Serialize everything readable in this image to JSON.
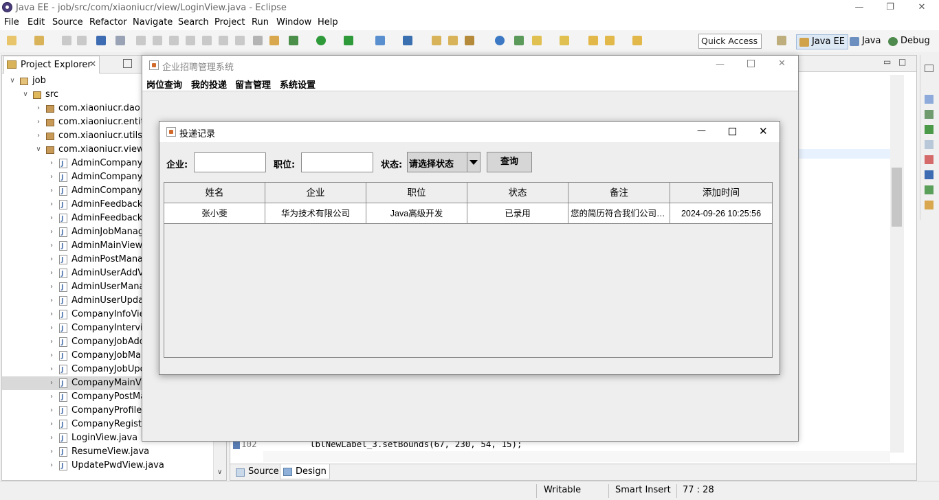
{
  "eclipse": {
    "title": "Java EE - job/src/com/xiaoniucr/view/LoginView.java - Eclipse",
    "menu": [
      "File",
      "Edit",
      "Source",
      "Refactor",
      "Navigate",
      "Search",
      "Project",
      "Run",
      "Window",
      "Help"
    ],
    "quick_access": "Quick Access",
    "perspectives": [
      "Java EE",
      "Java",
      "Debug"
    ],
    "explorer_tab": "Project Explorer",
    "tree": [
      {
        "label": "job",
        "level": 0,
        "type": "project",
        "expanded": true
      },
      {
        "label": "src",
        "level": 1,
        "type": "folder",
        "expanded": true
      },
      {
        "label": "com.xiaoniucr.dao",
        "level": 2,
        "type": "package",
        "expanded": false
      },
      {
        "label": "com.xiaoniucr.entity",
        "level": 2,
        "type": "package",
        "expanded": false
      },
      {
        "label": "com.xiaoniucr.utils",
        "level": 2,
        "type": "package",
        "expanded": false
      },
      {
        "label": "com.xiaoniucr.view",
        "level": 2,
        "type": "package",
        "expanded": true
      },
      {
        "label": "AdminCompanyA",
        "level": 3,
        "type": "java"
      },
      {
        "label": "AdminCompanyM",
        "level": 3,
        "type": "java"
      },
      {
        "label": "AdminCompanyU",
        "level": 3,
        "type": "java"
      },
      {
        "label": "AdminFeedbackM",
        "level": 3,
        "type": "java"
      },
      {
        "label": "AdminFeedbackR",
        "level": 3,
        "type": "java"
      },
      {
        "label": "AdminJobManag",
        "level": 3,
        "type": "java"
      },
      {
        "label": "AdminMainView.j",
        "level": 3,
        "type": "java"
      },
      {
        "label": "AdminPostManag",
        "level": 3,
        "type": "java"
      },
      {
        "label": "AdminUserAddVi",
        "level": 3,
        "type": "java"
      },
      {
        "label": "AdminUserManag",
        "level": 3,
        "type": "java"
      },
      {
        "label": "AdminUserUpdat",
        "level": 3,
        "type": "java"
      },
      {
        "label": "CompanyInfoView",
        "level": 3,
        "type": "java"
      },
      {
        "label": "CompanyIntervie",
        "level": 3,
        "type": "java"
      },
      {
        "label": "CompanyJobAdd",
        "level": 3,
        "type": "java"
      },
      {
        "label": "CompanyJobMar",
        "level": 3,
        "type": "java"
      },
      {
        "label": "CompanyJobUpd",
        "level": 3,
        "type": "java"
      },
      {
        "label": "CompanyMainVie",
        "level": 3,
        "type": "java",
        "selected": true
      },
      {
        "label": "CompanyPostMa",
        "level": 3,
        "type": "java"
      },
      {
        "label": "CompanyProfileV",
        "level": 3,
        "type": "java"
      },
      {
        "label": "CompanyRegister",
        "level": 3,
        "type": "java"
      },
      {
        "label": "LoginView.java",
        "level": 3,
        "type": "java"
      },
      {
        "label": "ResumeView.java",
        "level": 3,
        "type": "java"
      },
      {
        "label": "UpdatePwdView.java",
        "level": 3,
        "type": "java"
      }
    ],
    "editor_line_number": "102",
    "editor_code": "lblNewLabel_3.setBounds(67, 230, 54, 15);",
    "editor_tabs": [
      "Source",
      "Design"
    ],
    "status": [
      "Writable",
      "Smart Insert",
      "77 : 28"
    ]
  },
  "main_window": {
    "title": "企业招聘管理系统",
    "menu": [
      "岗位查询",
      "我的投递",
      "留言管理",
      "系统设置"
    ]
  },
  "dialog": {
    "title": "投递记录",
    "company_label": "企业:",
    "position_label": "职位:",
    "status_label": "状态:",
    "status_value": "请选择状态",
    "query_button": "查询",
    "columns": [
      "姓名",
      "企业",
      "职位",
      "状态",
      "备注",
      "添加时间"
    ],
    "rows": [
      [
        "张小斐",
        "华为技术有限公司",
        "Java高级开发",
        "已录用",
        "您的简历符合我们公司的...",
        "2024-09-26 10:25:56"
      ]
    ]
  }
}
